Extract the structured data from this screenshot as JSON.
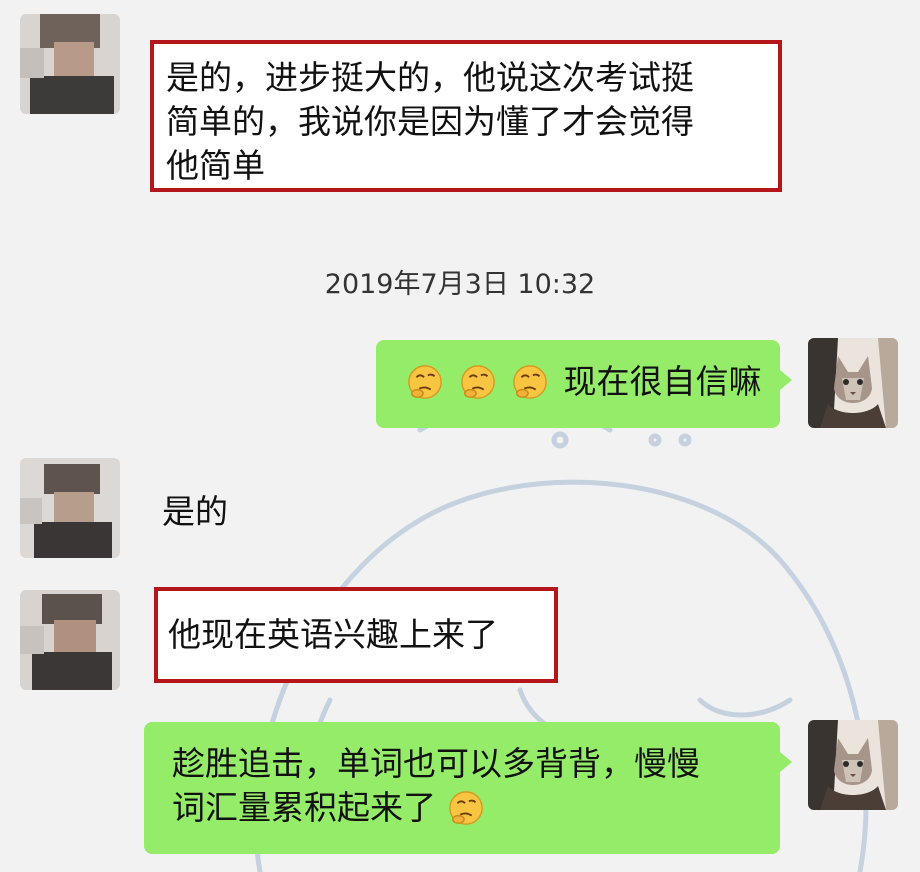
{
  "chat": {
    "timestamp": "2019年7月3日 10:32",
    "messages": [
      {
        "sender": "contact",
        "text_line1": "是的，进步挺大的，他说这次考试挺",
        "text_line2": "简单的，我说你是因为懂了才会觉得",
        "text_line3": "他简单",
        "highlighted": true
      },
      {
        "sender": "me",
        "emoji_icon": "thinking-face-emoji",
        "emoji_count": 3,
        "text": "现在很自信嘛"
      },
      {
        "sender": "contact",
        "text": "是的"
      },
      {
        "sender": "contact",
        "text": "他现在英语兴趣上来了",
        "highlighted": true
      },
      {
        "sender": "me",
        "text_line1": "趁胜追击，单词也可以多背背，慢慢",
        "text_line2": "词汇量累积起来了",
        "emoji_icon": "thinking-face-emoji"
      }
    ]
  },
  "colors": {
    "sent_bubble": "#95ec69",
    "received_bubble": "#ffffff",
    "highlight_border": "#b4161b",
    "background": "#f2f2f2"
  }
}
